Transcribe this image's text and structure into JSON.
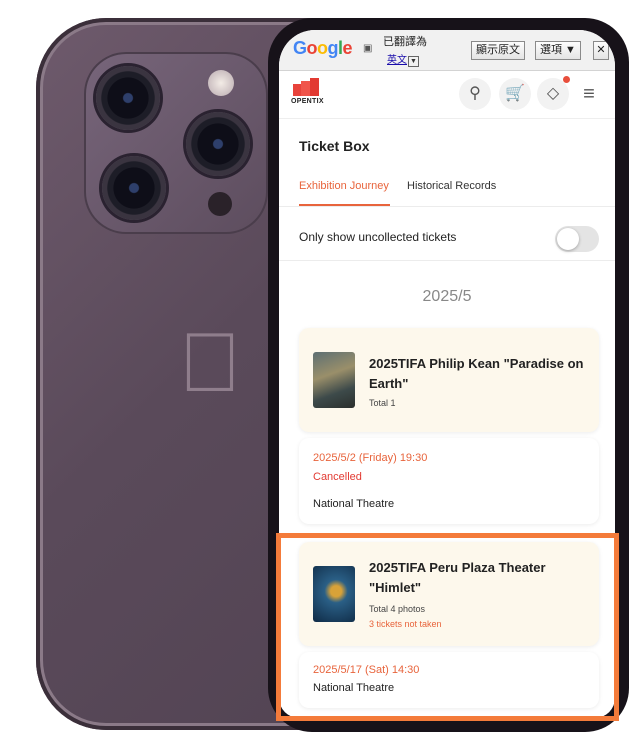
{
  "translate_bar": {
    "logo_letters": [
      "G",
      "o",
      "o",
      "g",
      "l",
      "e"
    ],
    "translated_label": "已翻譯為",
    "language": "英文",
    "language_arrow": "▼",
    "show_original": "顯示原文",
    "options": "選項 ▼",
    "close": "✕"
  },
  "header": {
    "brand": "OPENTIX",
    "icons": [
      "search-icon",
      "cart-icon",
      "ticket-icon",
      "menu-icon"
    ]
  },
  "page": {
    "title": "Ticket Box",
    "tabs": [
      "Exhibition Journey",
      "Historical Records"
    ],
    "toggle_label": "Only show uncollected tickets",
    "toggle_on": false,
    "month": "2025/5"
  },
  "events": [
    {
      "title": "2025TIFA Philip Kean \"Paradise on Earth\"",
      "total": "Total 1",
      "date": "2025/5/2 (Friday) 19:30",
      "status": "Cancelled",
      "venue": "National Theatre"
    },
    {
      "title": "2025TIFA Peru Plaza Theater \"Himlet\"",
      "total": "Total 4 photos",
      "warning": "3 tickets not taken",
      "date": "2025/5/17 (Sat) 14:30",
      "venue": "National Theatre"
    }
  ],
  "colors": {
    "accent": "#e8643c",
    "cancelled": "#e23a32",
    "highlight": "#f47b3a",
    "phone": "#5a4a5a"
  }
}
